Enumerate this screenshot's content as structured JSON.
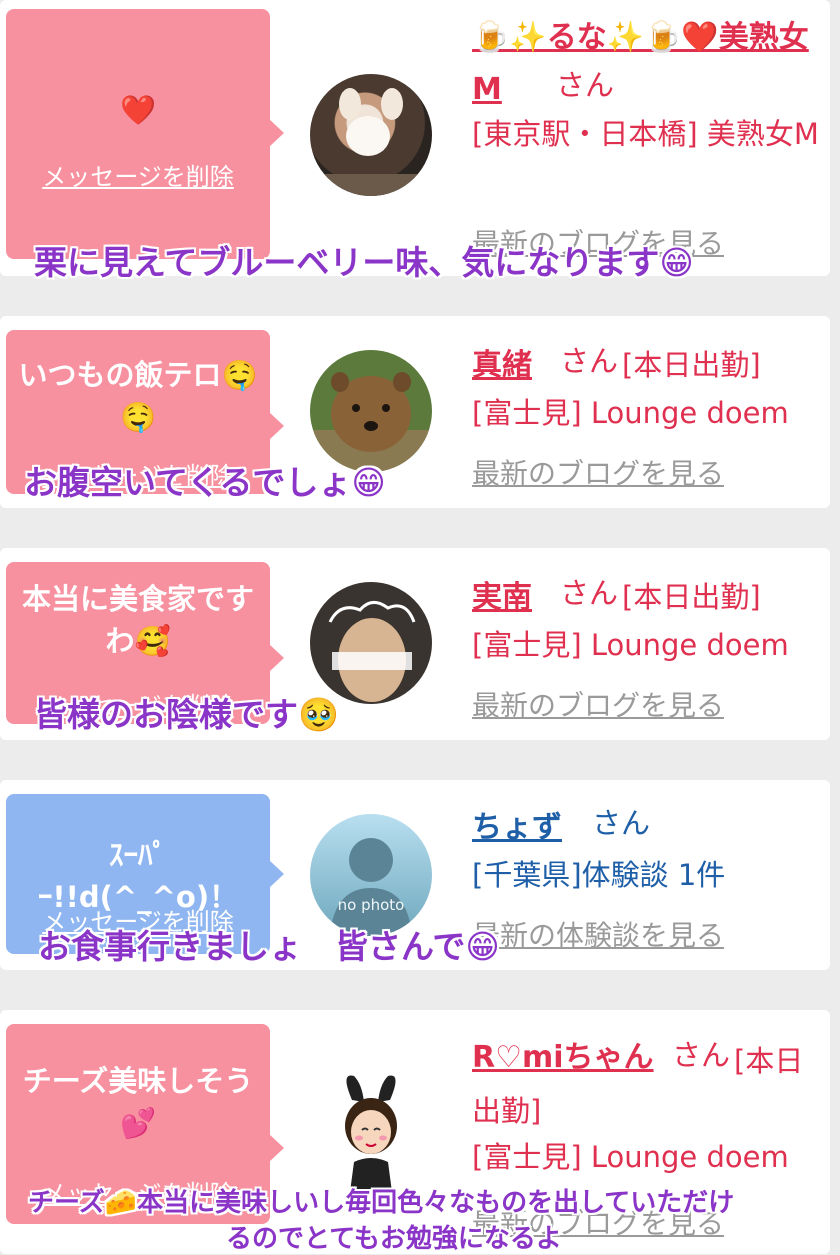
{
  "cards": [
    {
      "message": "❤️",
      "delete_label": "メッセージを削除",
      "name": "🍺✨るな✨🍺❤️美熟女M",
      "san": "さん",
      "shop": "[東京駅・日本橋] 美熟女M",
      "blog_link": "最新のブログを見る",
      "caption": "栗に見えてブルーベリー味、気になります😁"
    },
    {
      "message": "いつもの飯テロ🤤🤤",
      "delete_label": "メッセージを削除",
      "name": "真緒",
      "san": "さん",
      "tag": "[本日出勤]",
      "shop": "[富士見] Lounge doem",
      "blog_link": "最新のブログを見る",
      "caption": "お腹空いてくるでしょ😁"
    },
    {
      "message": "本当に美食家ですわ🥰",
      "delete_label": "メッセージを削除",
      "name": "実南",
      "san": "さん",
      "tag": "[本日出勤]",
      "shop": "[富士見] Lounge doem",
      "blog_link": "最新のブログを見る",
      "caption": "皆様のお陰様です🥹"
    },
    {
      "message": "ｽｰﾊﾟｰ!!d(^_^o)！",
      "delete_label": "メッセージを削除",
      "name": "ちょず",
      "san": "さん",
      "shop": "[千葉県]体験談 1件",
      "avatar_text": "no photo",
      "blog_link": "最新の体験談を見る",
      "caption": "お食事行きましょ　皆さんで😁"
    },
    {
      "message": "チーズ美味しそう💕",
      "delete_label": "メッセージを削除",
      "name": "R♡miちゃん",
      "san": "さん",
      "tag": "[本日出勤]",
      "shop": "[富士見] Lounge doem",
      "blog_link": "最新のブログを見る",
      "caption_line1": "チーズ🧀本当に美味しいし毎回色々なものを出していただけ",
      "caption_line2": "るのでとてもお勉強になるよ"
    }
  ],
  "colors": {
    "pink_bubble": "#f7919f",
    "blue_bubble": "#8fb6f0",
    "name_red": "#e0304f",
    "name_navy": "#1f5fa8",
    "caption_purple": "#8a35c8"
  }
}
